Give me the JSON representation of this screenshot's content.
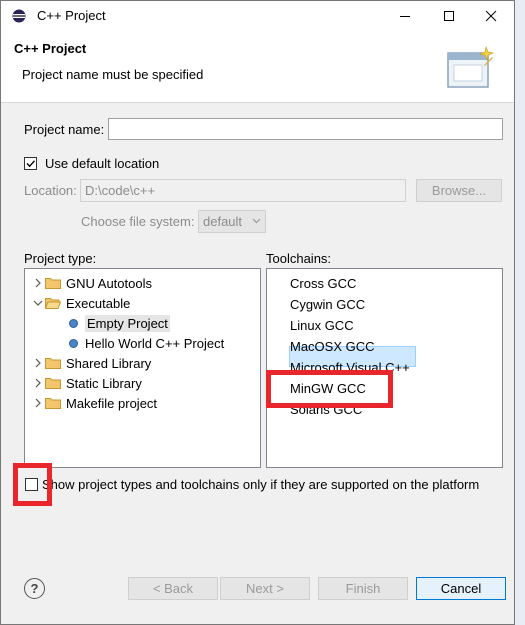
{
  "window": {
    "title": "C++ Project"
  },
  "header": {
    "title": "C++ Project",
    "message": "Project name must be specified"
  },
  "form": {
    "project_name_label": "Project name:",
    "project_name_value": "",
    "use_default_location_label": "Use default location",
    "use_default_location_checked": true,
    "location_label": "Location:",
    "location_value": "D:\\code\\c++",
    "browse_label": "Browse...",
    "file_system_label": "Choose file system:",
    "file_system_value": "default"
  },
  "project_type": {
    "label": "Project type:",
    "items": [
      {
        "label": "GNU Autotools",
        "kind": "folder",
        "expanded": false,
        "level": 0
      },
      {
        "label": "Executable",
        "kind": "folder",
        "expanded": true,
        "level": 0
      },
      {
        "label": "Empty Project",
        "kind": "leaf",
        "level": 1,
        "selected": true
      },
      {
        "label": "Hello World C++ Project",
        "kind": "leaf",
        "level": 1
      },
      {
        "label": "Shared Library",
        "kind": "folder",
        "expanded": false,
        "level": 0
      },
      {
        "label": "Static Library",
        "kind": "folder",
        "expanded": false,
        "level": 0
      },
      {
        "label": "Makefile project",
        "kind": "folder",
        "expanded": false,
        "level": 0
      }
    ]
  },
  "toolchains": {
    "label": "Toolchains:",
    "items": [
      "Cross GCC",
      "Cygwin GCC",
      "Linux GCC",
      "MacOSX GCC",
      "Microsoft Visual C++",
      "MinGW GCC",
      "Solaris GCC"
    ],
    "selected": "MinGW GCC"
  },
  "filter_checkbox": {
    "label": "Show project types and toolchains only if they are supported on the platform",
    "checked": false
  },
  "buttons": {
    "back": "< Back",
    "next": "Next >",
    "finish": "Finish",
    "cancel": "Cancel"
  },
  "colors": {
    "highlight_red": "#e8262c",
    "selection_blue": "#cde8ff"
  }
}
